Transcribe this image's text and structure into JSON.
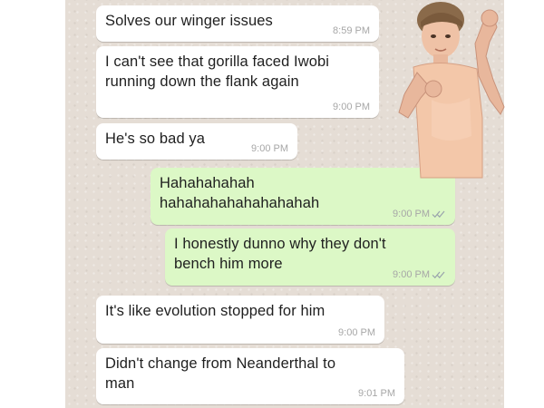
{
  "chat": {
    "messages": [
      {
        "direction": "in",
        "text": "Solves our winger issues",
        "time": "8:59 PM"
      },
      {
        "direction": "in",
        "text": "I can't see that gorilla faced Iwobi\nrunning down the flank again",
        "time": "9:00 PM"
      },
      {
        "direction": "in",
        "text": "He's so bad ya",
        "time": "9:00 PM"
      },
      {
        "direction": "out",
        "text": "Hahahahahah\nhahahahahahahahahah",
        "time": "9:00 PM",
        "status": "double-check-icon"
      },
      {
        "direction": "out",
        "text": "I honestly dunno why they don't\nbench him more",
        "time": "9:00 PM",
        "status": "double-check-icon"
      },
      {
        "direction": "in",
        "text": "It's like evolution stopped for him",
        "time": "9:00 PM"
      },
      {
        "direction": "in",
        "text": "Didn't change from Neanderthal to\nman",
        "time": "9:01 PM"
      }
    ]
  },
  "sticker": {
    "name": "kid-dancing-sticker"
  },
  "colors": {
    "chat_background": "#e5ddd5",
    "incoming_bubble": "#ffffff",
    "outgoing_bubble": "#dcf8c6",
    "timestamp": "#a7a7a7"
  }
}
